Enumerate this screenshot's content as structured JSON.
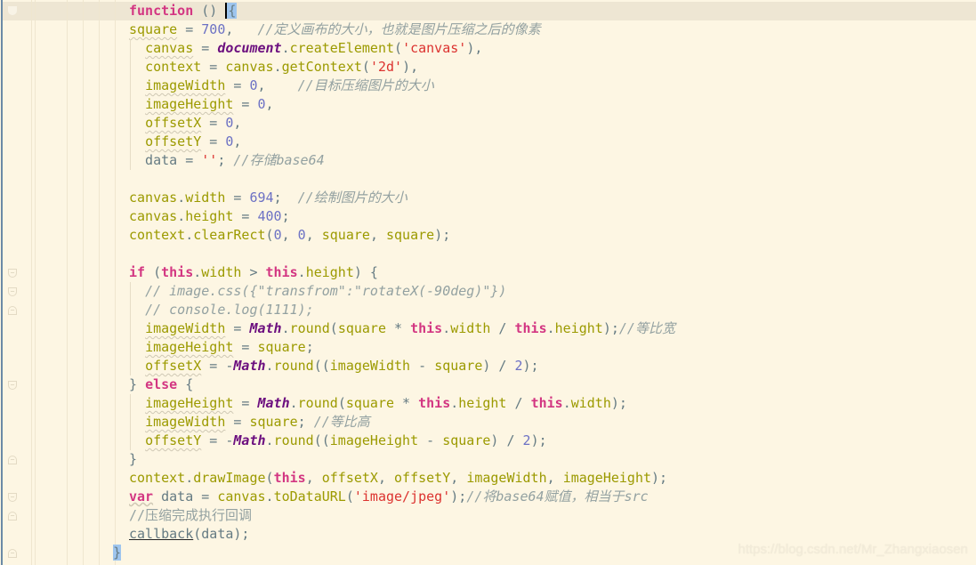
{
  "editor": {
    "theme": {
      "background": "#fdf6e3",
      "current_line": "#eee6d3",
      "keyword": "#d33682",
      "variable": "#9c9a00",
      "number": "#6c71c4",
      "string": "#dc322f",
      "comment": "#93a1a1",
      "global": "#6c0f7f"
    },
    "lines": [
      [
        {
          "t": "kw",
          "v": "function"
        },
        {
          "t": "punc",
          "v": " () "
        },
        {
          "t": "caret",
          "v": "{"
        }
      ],
      [
        {
          "t": "var sq",
          "v": "square"
        },
        {
          "t": "punc",
          "v": " = "
        },
        {
          "t": "num",
          "v": "700"
        },
        {
          "t": "punc",
          "v": ",   "
        },
        {
          "t": "cmt",
          "v": "//定义画布的大小，也就是图片压缩之后的像素"
        }
      ],
      [
        {
          "t": "punc",
          "v": "  "
        },
        {
          "t": "var sq",
          "v": "canvas"
        },
        {
          "t": "punc",
          "v": " = "
        },
        {
          "t": "glob",
          "v": "document"
        },
        {
          "t": "punc",
          "v": "."
        },
        {
          "t": "fn",
          "v": "createElement"
        },
        {
          "t": "punc",
          "v": "("
        },
        {
          "t": "str",
          "v": "'canvas'"
        },
        {
          "t": "punc",
          "v": "),"
        }
      ],
      [
        {
          "t": "punc",
          "v": "  "
        },
        {
          "t": "var",
          "v": "context"
        },
        {
          "t": "punc",
          "v": " = "
        },
        {
          "t": "var",
          "v": "canvas"
        },
        {
          "t": "punc",
          "v": "."
        },
        {
          "t": "fn",
          "v": "getContext"
        },
        {
          "t": "punc",
          "v": "("
        },
        {
          "t": "str",
          "v": "'2d'"
        },
        {
          "t": "punc",
          "v": "),"
        }
      ],
      [
        {
          "t": "punc",
          "v": "  "
        },
        {
          "t": "var sq",
          "v": "imageWidth"
        },
        {
          "t": "punc",
          "v": " = "
        },
        {
          "t": "num",
          "v": "0"
        },
        {
          "t": "punc",
          "v": ",    "
        },
        {
          "t": "cmt",
          "v": "//目标压缩图片的大小"
        }
      ],
      [
        {
          "t": "punc",
          "v": "  "
        },
        {
          "t": "var sq",
          "v": "imageHeight"
        },
        {
          "t": "punc",
          "v": " = "
        },
        {
          "t": "num",
          "v": "0"
        },
        {
          "t": "punc",
          "v": ","
        }
      ],
      [
        {
          "t": "punc",
          "v": "  "
        },
        {
          "t": "var sq",
          "v": "offsetX"
        },
        {
          "t": "punc",
          "v": " = "
        },
        {
          "t": "num",
          "v": "0"
        },
        {
          "t": "punc",
          "v": ","
        }
      ],
      [
        {
          "t": "punc",
          "v": "  "
        },
        {
          "t": "var sq",
          "v": "offsetY"
        },
        {
          "t": "punc",
          "v": " = "
        },
        {
          "t": "num",
          "v": "0"
        },
        {
          "t": "punc",
          "v": ","
        }
      ],
      [
        {
          "t": "punc",
          "v": "  data = "
        },
        {
          "t": "str",
          "v": "''"
        },
        {
          "t": "punc",
          "v": "; "
        },
        {
          "t": "cmt",
          "v": "//存储base64"
        }
      ],
      [],
      [
        {
          "t": "var",
          "v": "canvas"
        },
        {
          "t": "punc",
          "v": "."
        },
        {
          "t": "var",
          "v": "width"
        },
        {
          "t": "punc",
          "v": " = "
        },
        {
          "t": "num",
          "v": "694"
        },
        {
          "t": "punc",
          "v": ";  "
        },
        {
          "t": "cmt",
          "v": "//绘制图片的大小"
        }
      ],
      [
        {
          "t": "var",
          "v": "canvas"
        },
        {
          "t": "punc",
          "v": "."
        },
        {
          "t": "var",
          "v": "height"
        },
        {
          "t": "punc",
          "v": " = "
        },
        {
          "t": "num",
          "v": "400"
        },
        {
          "t": "punc",
          "v": ";"
        }
      ],
      [
        {
          "t": "var",
          "v": "context"
        },
        {
          "t": "punc",
          "v": "."
        },
        {
          "t": "fn",
          "v": "clearRect"
        },
        {
          "t": "punc",
          "v": "("
        },
        {
          "t": "num",
          "v": "0"
        },
        {
          "t": "punc",
          "v": ", "
        },
        {
          "t": "num",
          "v": "0"
        },
        {
          "t": "punc",
          "v": ", "
        },
        {
          "t": "var",
          "v": "square"
        },
        {
          "t": "punc",
          "v": ", "
        },
        {
          "t": "var",
          "v": "square"
        },
        {
          "t": "punc",
          "v": ");"
        }
      ],
      [],
      [
        {
          "t": "kw",
          "v": "if"
        },
        {
          "t": "punc",
          "v": " ("
        },
        {
          "t": "kw",
          "v": "this"
        },
        {
          "t": "punc",
          "v": "."
        },
        {
          "t": "var",
          "v": "width"
        },
        {
          "t": "punc",
          "v": " > "
        },
        {
          "t": "kw",
          "v": "this"
        },
        {
          "t": "punc",
          "v": "."
        },
        {
          "t": "var",
          "v": "height"
        },
        {
          "t": "punc",
          "v": ") {"
        }
      ],
      [
        {
          "t": "punc",
          "v": "  "
        },
        {
          "t": "cmt",
          "v": "// image.css({\"transfrom\":\"rotateX(-90deg)\"})"
        }
      ],
      [
        {
          "t": "punc",
          "v": "  "
        },
        {
          "t": "cmt",
          "v": "// console.log(1111);"
        }
      ],
      [
        {
          "t": "punc",
          "v": "  "
        },
        {
          "t": "var sq",
          "v": "imageWidth"
        },
        {
          "t": "punc",
          "v": " = "
        },
        {
          "t": "glob",
          "v": "Math"
        },
        {
          "t": "punc",
          "v": "."
        },
        {
          "t": "fn",
          "v": "round"
        },
        {
          "t": "punc",
          "v": "("
        },
        {
          "t": "var",
          "v": "square"
        },
        {
          "t": "punc",
          "v": " * "
        },
        {
          "t": "kw",
          "v": "this"
        },
        {
          "t": "punc",
          "v": "."
        },
        {
          "t": "var",
          "v": "width"
        },
        {
          "t": "punc",
          "v": " / "
        },
        {
          "t": "kw",
          "v": "this"
        },
        {
          "t": "punc",
          "v": "."
        },
        {
          "t": "var",
          "v": "height"
        },
        {
          "t": "punc",
          "v": ");"
        },
        {
          "t": "cmt",
          "v": "//等比宽"
        }
      ],
      [
        {
          "t": "punc",
          "v": "  "
        },
        {
          "t": "var sq",
          "v": "imageHeight"
        },
        {
          "t": "punc",
          "v": " = "
        },
        {
          "t": "var",
          "v": "square"
        },
        {
          "t": "punc",
          "v": ";"
        }
      ],
      [
        {
          "t": "punc",
          "v": "  "
        },
        {
          "t": "var sq",
          "v": "offsetX"
        },
        {
          "t": "punc",
          "v": " = -"
        },
        {
          "t": "glob",
          "v": "Math"
        },
        {
          "t": "punc",
          "v": "."
        },
        {
          "t": "fn",
          "v": "round"
        },
        {
          "t": "punc",
          "v": "(("
        },
        {
          "t": "var",
          "v": "imageWidth"
        },
        {
          "t": "punc",
          "v": " - "
        },
        {
          "t": "var",
          "v": "square"
        },
        {
          "t": "punc",
          "v": ") / "
        },
        {
          "t": "num",
          "v": "2"
        },
        {
          "t": "punc",
          "v": ");"
        }
      ],
      [
        {
          "t": "punc",
          "v": "} "
        },
        {
          "t": "kw",
          "v": "else"
        },
        {
          "t": "punc",
          "v": " {"
        }
      ],
      [
        {
          "t": "punc",
          "v": "  "
        },
        {
          "t": "var sq",
          "v": "imageHeight"
        },
        {
          "t": "punc",
          "v": " = "
        },
        {
          "t": "glob",
          "v": "Math"
        },
        {
          "t": "punc",
          "v": "."
        },
        {
          "t": "fn",
          "v": "round"
        },
        {
          "t": "punc",
          "v": "("
        },
        {
          "t": "var",
          "v": "square"
        },
        {
          "t": "punc",
          "v": " * "
        },
        {
          "t": "kw",
          "v": "this"
        },
        {
          "t": "punc",
          "v": "."
        },
        {
          "t": "var",
          "v": "height"
        },
        {
          "t": "punc",
          "v": " / "
        },
        {
          "t": "kw",
          "v": "this"
        },
        {
          "t": "punc",
          "v": "."
        },
        {
          "t": "var",
          "v": "width"
        },
        {
          "t": "punc",
          "v": ");"
        }
      ],
      [
        {
          "t": "punc",
          "v": "  "
        },
        {
          "t": "var sq",
          "v": "imageWidth"
        },
        {
          "t": "punc",
          "v": " = "
        },
        {
          "t": "var",
          "v": "square"
        },
        {
          "t": "punc",
          "v": "; "
        },
        {
          "t": "cmt",
          "v": "//等比高"
        }
      ],
      [
        {
          "t": "punc",
          "v": "  "
        },
        {
          "t": "var sq",
          "v": "offsetY"
        },
        {
          "t": "punc",
          "v": " = -"
        },
        {
          "t": "glob",
          "v": "Math"
        },
        {
          "t": "punc",
          "v": "."
        },
        {
          "t": "fn",
          "v": "round"
        },
        {
          "t": "punc",
          "v": "(("
        },
        {
          "t": "var",
          "v": "imageHeight"
        },
        {
          "t": "punc",
          "v": " - "
        },
        {
          "t": "var",
          "v": "square"
        },
        {
          "t": "punc",
          "v": ") / "
        },
        {
          "t": "num",
          "v": "2"
        },
        {
          "t": "punc",
          "v": ");"
        }
      ],
      [
        {
          "t": "punc",
          "v": "}"
        }
      ],
      [
        {
          "t": "var",
          "v": "context"
        },
        {
          "t": "punc",
          "v": "."
        },
        {
          "t": "fn",
          "v": "drawImage"
        },
        {
          "t": "punc",
          "v": "("
        },
        {
          "t": "kw",
          "v": "this"
        },
        {
          "t": "punc",
          "v": ", "
        },
        {
          "t": "var",
          "v": "offsetX"
        },
        {
          "t": "punc",
          "v": ", "
        },
        {
          "t": "var",
          "v": "offsetY"
        },
        {
          "t": "punc",
          "v": ", "
        },
        {
          "t": "var",
          "v": "imageWidth"
        },
        {
          "t": "punc",
          "v": ", "
        },
        {
          "t": "var",
          "v": "imageHeight"
        },
        {
          "t": "punc",
          "v": ");"
        }
      ],
      [
        {
          "t": "kw sqk",
          "v": "var"
        },
        {
          "t": "punc",
          "v": " data = "
        },
        {
          "t": "var",
          "v": "canvas"
        },
        {
          "t": "punc",
          "v": "."
        },
        {
          "t": "fn",
          "v": "toDataURL"
        },
        {
          "t": "punc",
          "v": "("
        },
        {
          "t": "str",
          "v": "'image/jpeg'"
        },
        {
          "t": "punc",
          "v": ");"
        },
        {
          "t": "cmt",
          "v": "//将base64赋值，相当于src"
        }
      ],
      [
        {
          "t": "cmt-cn",
          "v": "//压缩完成执行回调"
        }
      ],
      [
        {
          "t": "callback",
          "v": "callback"
        },
        {
          "t": "punc",
          "v": "(data);"
        }
      ]
    ],
    "closing_brace": "}"
  },
  "watermark": "https://blog.csdn.net/Mr_Zhangxiaosen"
}
